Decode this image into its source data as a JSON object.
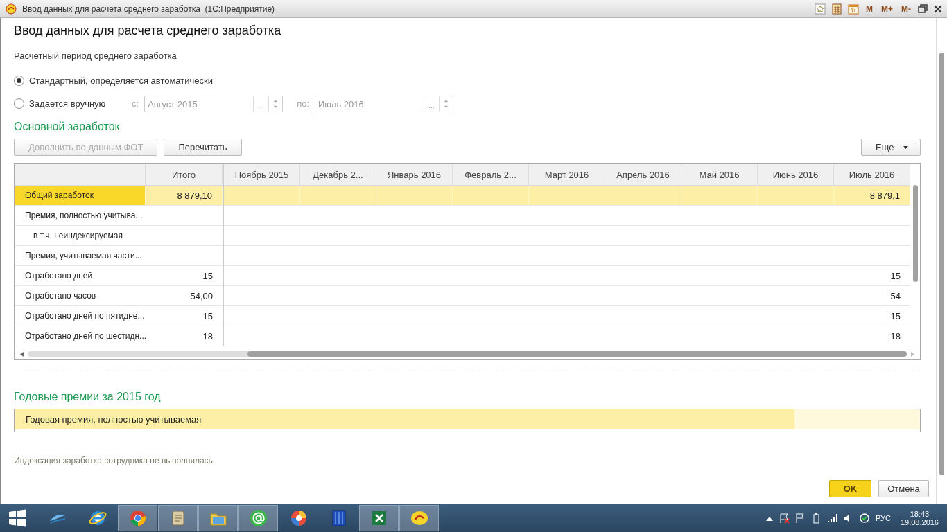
{
  "window": {
    "title": "Ввод данных для расчета среднего заработка  (1С:Предприятие)",
    "memory_buttons": [
      "M",
      "M+",
      "M-"
    ]
  },
  "form": {
    "title": "Ввод данных для расчета среднего заработка"
  },
  "period": {
    "label": "Расчетный период среднего заработка",
    "options": [
      {
        "label": "Стандартный, определяется автоматически",
        "selected": true
      },
      {
        "label": "Задается вручную",
        "selected": false
      }
    ],
    "range": {
      "disabled": true,
      "from_label": "с:",
      "from_value": "Август 2015",
      "from_picker": "...",
      "to_label": "по:",
      "to_value": "Июль 2016",
      "to_picker": "..."
    }
  },
  "main_section": {
    "heading": "Основной заработок",
    "buttons": [
      {
        "label": "Дополнить по данным ФОТ",
        "disabled": true
      },
      {
        "label": "Перечитать",
        "disabled": false
      }
    ],
    "more_button": "Еще",
    "table": {
      "columns": [
        "Итого",
        "Ноябрь 2015",
        "Декабрь 2...",
        "Январь 2016",
        "Февраль 2...",
        "Март 2016",
        "Апрель 2016",
        "Май 2016",
        "Июнь 2016",
        "Июль 2016"
      ],
      "rows": [
        {
          "label": "Общий заработок",
          "selected": true,
          "total": "8 879,10",
          "last": "8 879,1"
        },
        {
          "label": "Премия, полностью учитыва...",
          "selected": false,
          "children": [
            {
              "label": "в т.ч. неиндексируемая",
              "selected": false
            }
          ]
        },
        {
          "label": "Премия, учитываемая части...",
          "selected": false
        },
        {
          "label": "Отработано дней",
          "selected": false,
          "total": "15",
          "last": "15"
        },
        {
          "label": "Отработано часов",
          "selected": false,
          "total": "54,00",
          "last": "54"
        },
        {
          "label": "Отработано дней по пятидне...",
          "selected": false,
          "total": "15",
          "last": "15"
        },
        {
          "label": "Отработано дней по шестидн...",
          "selected": false,
          "total": "18",
          "last": "18"
        }
      ]
    }
  },
  "bonus_section": {
    "heading": "Годовые премии за 2015 год",
    "rows": [
      {
        "label": "Годовая премия, полностью учитываемая",
        "selected": true
      }
    ]
  },
  "note": "Индексация заработка сотрудника не выполнялась",
  "dialog_buttons": [
    {
      "label": "OK",
      "default": true
    },
    {
      "label": "Отмена",
      "default": false
    }
  ],
  "taskbar": {
    "apps": [
      {
        "kind": "feather",
        "running": false
      },
      {
        "kind": "globe-e",
        "running": false
      },
      {
        "kind": "chrome",
        "running": true
      },
      {
        "kind": "scroll",
        "running": true
      },
      {
        "kind": "folder",
        "running": true
      },
      {
        "kind": "at",
        "running": true
      },
      {
        "kind": "swirl",
        "running": false
      },
      {
        "kind": "server",
        "running": false
      },
      {
        "kind": "sheet",
        "running": true
      },
      {
        "kind": "onec",
        "running": true
      }
    ],
    "language": "РУС",
    "time": "18:43",
    "date": "19.08.2016"
  }
}
